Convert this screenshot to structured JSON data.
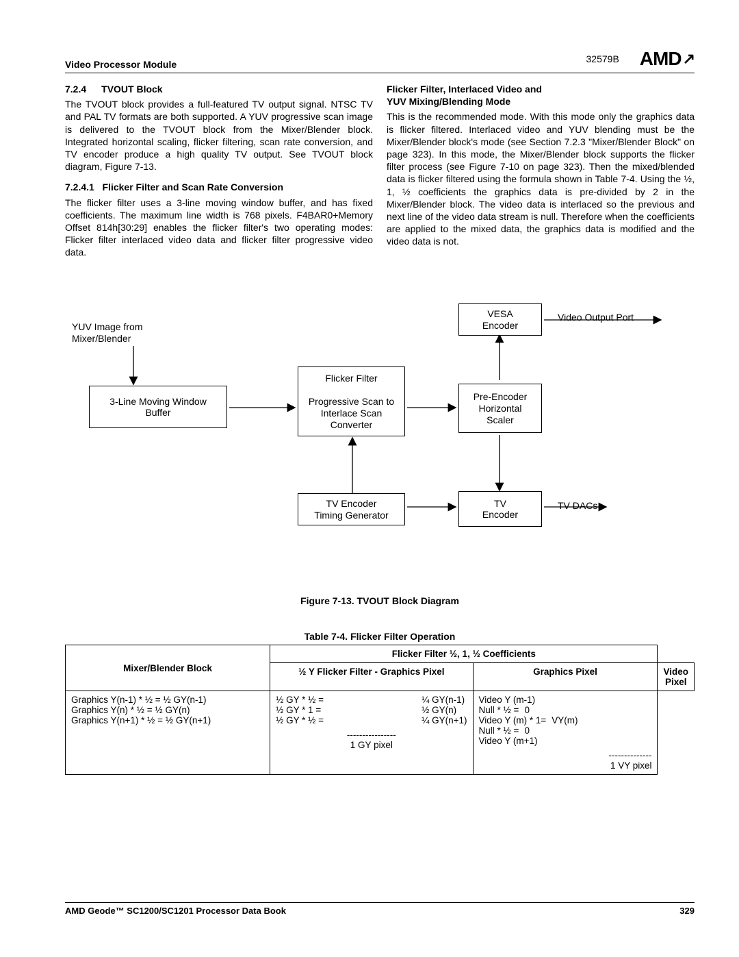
{
  "header": {
    "module": "Video Processor Module",
    "docnum": "32579B",
    "logo": "AMD"
  },
  "sec724": {
    "num": "7.2.4",
    "title": "TVOUT Block",
    "para1": "The TVOUT block provides a full-featured TV output signal. NTSC TV and PAL TV formats are both supported. A YUV progressive scan image is delivered to the TVOUT block from the Mixer/Blender block. Integrated horizontal scaling, flicker filtering, scan rate conversion, and TV encoder produce a high quality TV output. See TVOUT block diagram, Figure 7-13."
  },
  "sec7241": {
    "num": "7.2.4.1",
    "title": "Flicker Filter and Scan Rate Conversion",
    "para": "The flicker filter uses a 3-line moving window buffer, and has fixed coefficients. The maximum line width is 768 pixels. F4BAR0+Memory Offset 814h[30:29] enables the flicker filter's two operating modes: Flicker filter interlaced video data and flicker filter progressive video data."
  },
  "right": {
    "title1": "Flicker Filter, Interlaced Video and",
    "title2": "YUV Mixing/Blending Mode",
    "para": "This is the recommended mode. With this mode only the graphics data is flicker filtered. Interlaced video and YUV blending must be the Mixer/Blender block's mode (see Section 7.2.3 \"Mixer/Blender Block\" on page 323). In this mode, the Mixer/Blender block supports the flicker filter process (see Figure 7-10 on page 323). Then the mixed/blended data is flicker filtered using the formula shown in Table 7-4. Using the ½, 1, ½ coefficients the graphics data is pre-divided by 2 in the Mixer/Blender block. The video data is interlaced so the previous and next line of the video data stream is null. Therefore when the coefficients are applied to the mixed data, the graphics data is modified and the video data is not."
  },
  "diagram": {
    "yuv_label": "YUV Image from\nMixer/Blender",
    "buffer": "3-Line Moving Window\nBuffer",
    "ff": "Flicker Filter\n\nProgressive Scan to\nInterlace Scan\nConverter",
    "timing": "TV Encoder\nTiming Generator",
    "vesa": "VESA\nEncoder",
    "scaler": "Pre-Encoder\nHorizontal\nScaler",
    "tvenc": "TV\nEncoder",
    "vout": "Video Output Port",
    "tvdacs": "TV DACs"
  },
  "fig_caption": "Figure 7-13.  TVOUT Block Diagram",
  "table": {
    "caption": "Table 7-4.  Flicker Filter Operation",
    "h_mixer": "Mixer/Blender Block",
    "h_coeff": "Flicker Filter ½, 1, ½ Coefficients",
    "h_half": "½ Y Flicker Filter - Graphics Pixel",
    "h_gp": "Graphics Pixel",
    "h_vp": "Video Pixel",
    "c1": {
      "l1": "Graphics Y(n-1) * ½ = ½ GY(n-1)",
      "l2": "Graphics Y(n) * ½ = ½ GY(n)",
      "l3": "Graphics Y(n+1) * ½ = ½ GY(n+1)"
    },
    "c2": {
      "a1": "½ GY * ½ =",
      "b1": "¼ GY(n-1)",
      "a2": "½ GY * 1 =",
      "b2": "½ GY(n)",
      "a3": "½ GY * ½ =",
      "b3": "¼ GY(n+1)",
      "dash": "----------------",
      "sum": "1 GY pixel"
    },
    "c3": {
      "l1": "Video Y (m-1)",
      "a2": "Null * ½  =",
      "b2": "0",
      "a3": "Video Y (m) * 1=",
      "b3": "VY(m)",
      "a4": "Null * ½  =",
      "b4": "0",
      "l5": "Video Y (m+1)",
      "dash": "--------------",
      "sum": "1 VY pixel"
    }
  },
  "footer": {
    "left": "AMD Geode™ SC1200/SC1201 Processor Data Book",
    "right": "329"
  }
}
